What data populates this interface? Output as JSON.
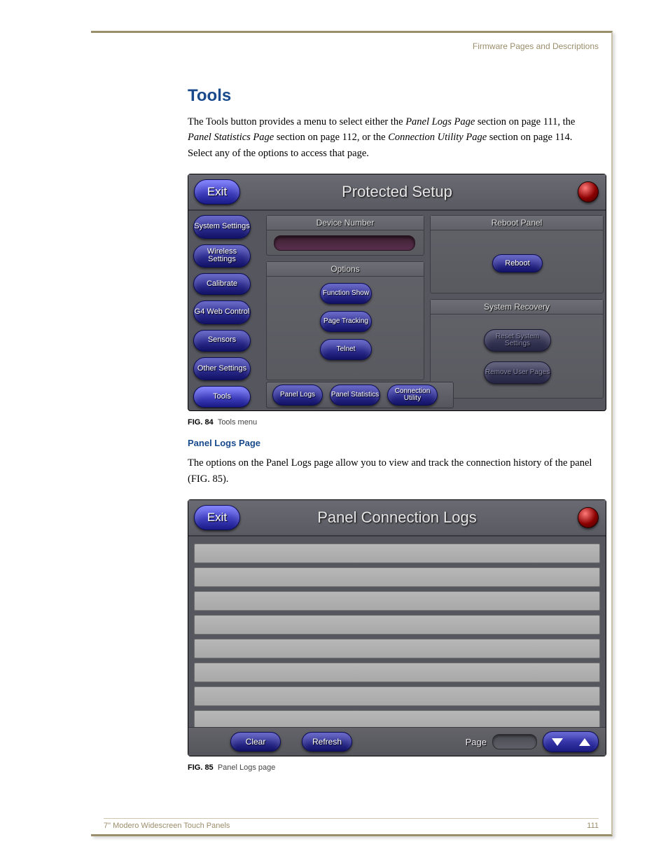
{
  "header": "Firmware Pages and Descriptions",
  "section_title": "Tools",
  "intro": {
    "t1": "The Tools button provides a menu to select either the ",
    "ref1": "Panel Logs Page",
    "t2": " section on page 111, the ",
    "ref2": "Panel Statistics Page",
    "t3": " section on page 112, or the ",
    "ref3": "Connection Utility Page",
    "t4": " section on page 114. Select any of the options to access that page."
  },
  "shot1": {
    "exit": "Exit",
    "title": "Protected Setup",
    "sidebar": [
      "System Settings",
      "Wireless Settings",
      "Calibrate",
      "G4 Web Control",
      "Sensors",
      "Other Settings",
      "Tools"
    ],
    "device_hdr": "Device Number",
    "options_hdr": "Options",
    "opt_buttons": [
      "Function Show",
      "Page Tracking",
      "Telnet"
    ],
    "reboot_hdr": "Reboot Panel",
    "reboot_btn": "Reboot",
    "sysrec_hdr": "System Recovery",
    "sysrec_btns": [
      "Reset System Settings",
      "Remove User Pages"
    ],
    "popup": [
      "Panel Logs",
      "Panel Statistics",
      "Connection Utility"
    ]
  },
  "fig84": {
    "label": "FIG. 84",
    "text": "Tools menu"
  },
  "sub_title": "Panel Logs Page",
  "logs_intro": "The options on the Panel Logs page allow you to view and track the connection history of the panel (FIG. 85).",
  "shot2": {
    "exit": "Exit",
    "title": "Panel Connection Logs",
    "clear": "Clear",
    "refresh": "Refresh",
    "page_label": "Page"
  },
  "fig85": {
    "label": "FIG. 85",
    "text": "Panel Logs page"
  },
  "footer": {
    "left": "7\" Modero Widescreen Touch Panels",
    "right": "111"
  }
}
